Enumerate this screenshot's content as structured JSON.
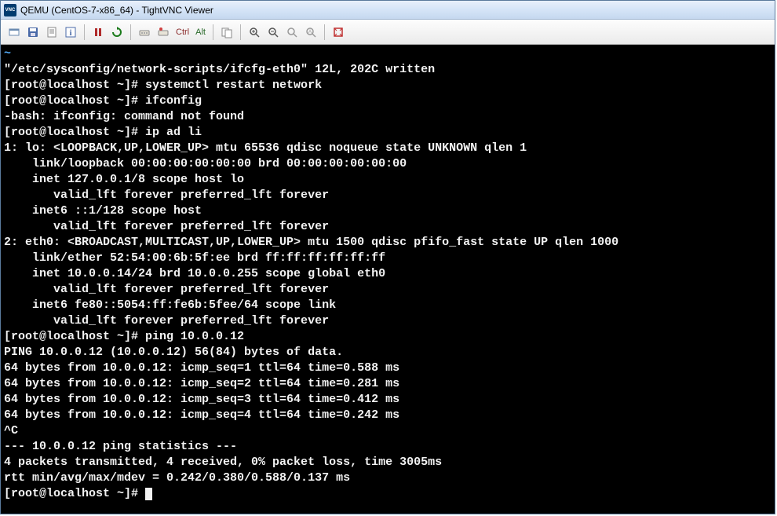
{
  "window": {
    "title": "QEMU (CentOS-7-x86_64) - TightVNC Viewer"
  },
  "toolbar": {
    "ctrl_label": "Ctrl",
    "alt_label": "Alt"
  },
  "terminal": {
    "lines": [
      "~",
      "\"/etc/sysconfig/network-scripts/ifcfg-eth0\" 12L, 202C written",
      "[root@localhost ~]# systemctl restart network",
      "[root@localhost ~]# ifconfig",
      "-bash: ifconfig: command not found",
      "[root@localhost ~]# ip ad li",
      "1: lo: <LOOPBACK,UP,LOWER_UP> mtu 65536 qdisc noqueue state UNKNOWN qlen 1",
      "    link/loopback 00:00:00:00:00:00 brd 00:00:00:00:00:00",
      "    inet 127.0.0.1/8 scope host lo",
      "       valid_lft forever preferred_lft forever",
      "    inet6 ::1/128 scope host",
      "       valid_lft forever preferred_lft forever",
      "2: eth0: <BROADCAST,MULTICAST,UP,LOWER_UP> mtu 1500 qdisc pfifo_fast state UP qlen 1000",
      "    link/ether 52:54:00:6b:5f:ee brd ff:ff:ff:ff:ff:ff",
      "    inet 10.0.0.14/24 brd 10.0.0.255 scope global eth0",
      "       valid_lft forever preferred_lft forever",
      "    inet6 fe80::5054:ff:fe6b:5fee/64 scope link",
      "       valid_lft forever preferred_lft forever",
      "[root@localhost ~]# ping 10.0.0.12",
      "PING 10.0.0.12 (10.0.0.12) 56(84) bytes of data.",
      "64 bytes from 10.0.0.12: icmp_seq=1 ttl=64 time=0.588 ms",
      "64 bytes from 10.0.0.12: icmp_seq=2 ttl=64 time=0.281 ms",
      "64 bytes from 10.0.0.12: icmp_seq=3 ttl=64 time=0.412 ms",
      "64 bytes from 10.0.0.12: icmp_seq=4 ttl=64 time=0.242 ms",
      "^C",
      "--- 10.0.0.12 ping statistics ---",
      "4 packets transmitted, 4 received, 0% packet loss, time 3005ms",
      "rtt min/avg/max/mdev = 0.242/0.380/0.588/0.137 ms",
      "[root@localhost ~]# "
    ]
  }
}
